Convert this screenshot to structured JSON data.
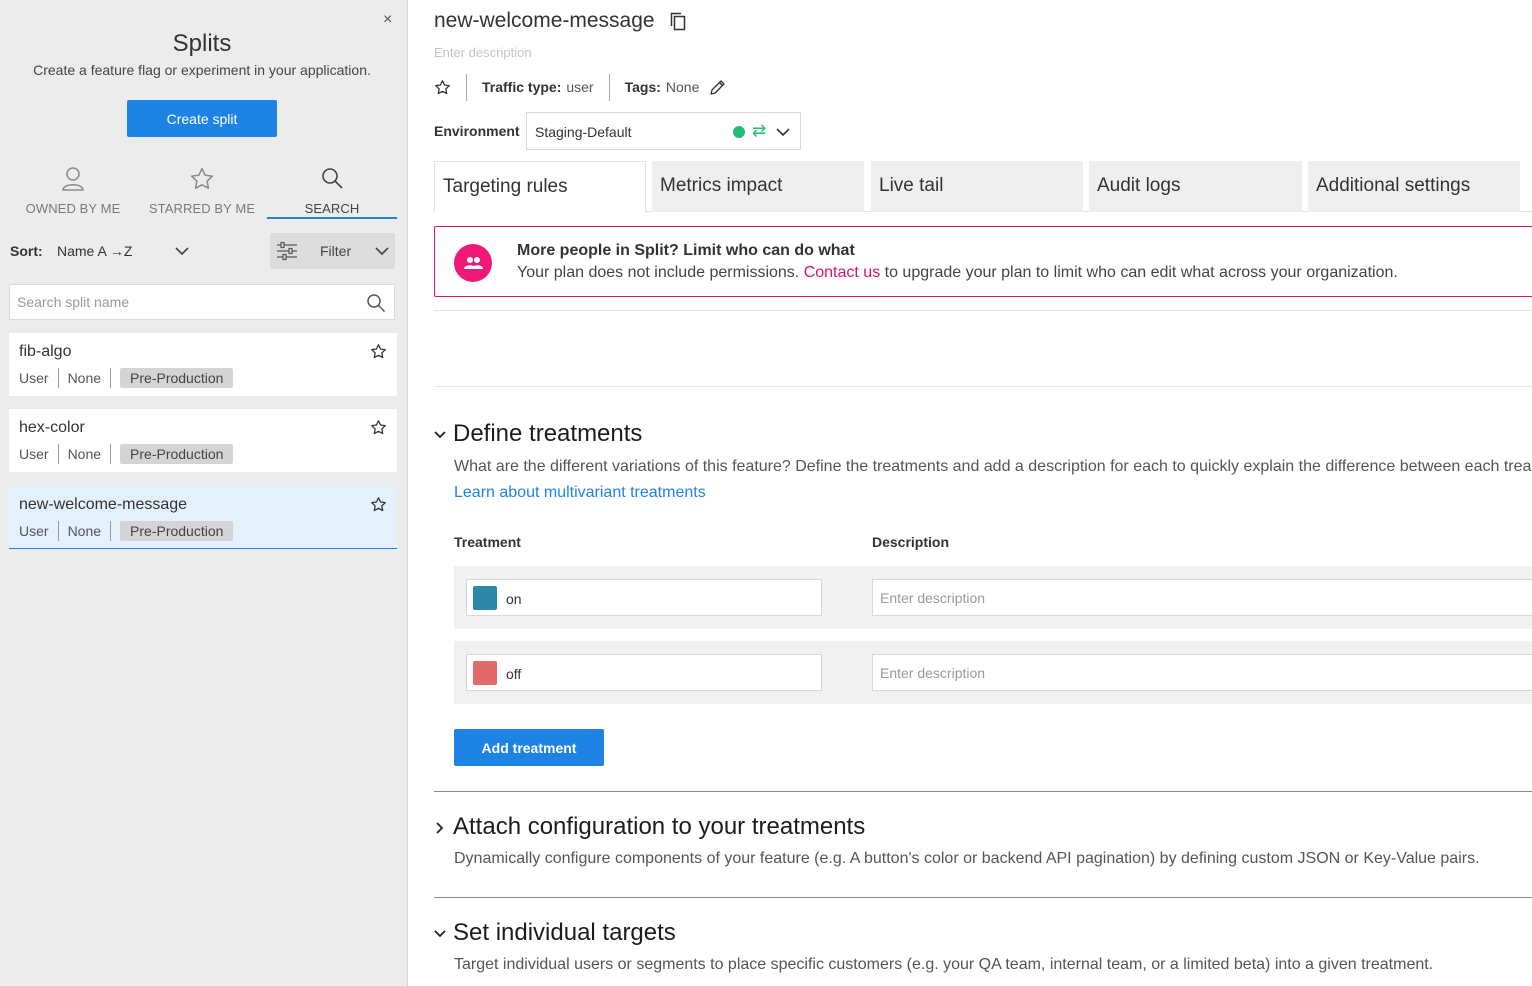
{
  "sidebar": {
    "close_glyph": "×",
    "title": "Splits",
    "subtitle": "Create a feature flag or experiment in your application.",
    "create_button": "Create split",
    "tabs": [
      {
        "label": "OWNED BY ME",
        "icon": "user-icon"
      },
      {
        "label": "STARRED BY ME",
        "icon": "star-icon"
      },
      {
        "label": "SEARCH",
        "icon": "search-icon",
        "active": true
      }
    ],
    "sort_label": "Sort:",
    "sort_value": "Name A →Z",
    "filter_label": "Filter",
    "search_placeholder": "Search split name",
    "splits": [
      {
        "name": "fib-algo",
        "traffic": "User",
        "tags": "None",
        "badge": "Pre-Production"
      },
      {
        "name": "hex-color",
        "traffic": "User",
        "tags": "None",
        "badge": "Pre-Production"
      },
      {
        "name": "new-welcome-message",
        "traffic": "User",
        "tags": "None",
        "badge": "Pre-Production",
        "selected": true
      }
    ]
  },
  "feature": {
    "name": "new-welcome-message",
    "description_placeholder": "Enter description",
    "traffic_type_label": "Traffic type:",
    "traffic_type_value": "user",
    "tags_label": "Tags:",
    "tags_value": "None"
  },
  "environment": {
    "label": "Environment",
    "value": "Staging-Default",
    "status_color": "#1fbe73",
    "swap_glyph": "⇄"
  },
  "tabs": [
    "Targeting rules",
    "Metrics impact",
    "Live tail",
    "Audit logs",
    "Additional settings"
  ],
  "banner": {
    "title": "More people in Split? Limit who can do what",
    "text_before": "Your plan does not include permissions. ",
    "link": "Contact us",
    "text_after": " to upgrade your plan to limit who can edit what across your organization.",
    "accent": "#e3117a"
  },
  "define_treatments": {
    "title": "Define treatments",
    "description": "What are the different variations of this feature? Define the treatments and add a description for each to quickly explain the difference between each treatment.",
    "link": "Learn about multivariant treatments",
    "col_treatment": "Treatment",
    "col_description": "Description",
    "treatments": [
      {
        "name": "on",
        "color": "#2e87a6",
        "description_placeholder": "Enter description"
      },
      {
        "name": "off",
        "color": "#e26a6a",
        "description_placeholder": "Enter description"
      }
    ],
    "add_button": "Add treatment"
  },
  "attach_config": {
    "title": "Attach configuration to your treatments",
    "description": "Dynamically configure components of your feature (e.g. A button's color or backend API pagination) by defining custom JSON or Key-Value pairs."
  },
  "individual_targets": {
    "title": "Set individual targets",
    "description": "Target individual users or segments to place specific customers (e.g. your QA team, internal team, or a limited beta) into a given treatment."
  },
  "colors": {
    "primary": "#1d84e5",
    "sidebar_bg": "#ececec"
  }
}
